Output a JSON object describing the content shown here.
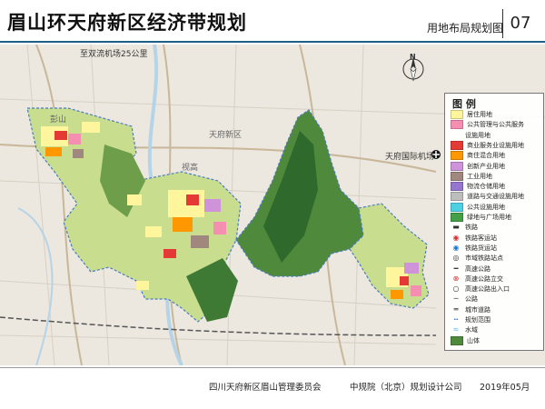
{
  "header": {
    "title": "眉山环天府新区经济带规划",
    "sheet_title": "用地布局规划图",
    "sheet_number": "07"
  },
  "map": {
    "labels": {
      "airport_distance": "至双流机场25公里",
      "airport": "天府国际机场",
      "north": "N",
      "place_1": "天府新区",
      "place_2": "视高",
      "place_3": "彭山"
    }
  },
  "legend": {
    "title": "图 例",
    "items": [
      {
        "label": "居住用地",
        "color": "#fff59d"
      },
      {
        "label": "公共管理与公共服务",
        "color": "#f48fb1"
      },
      {
        "label": "设施用地",
        "color": null
      },
      {
        "label": "商业服务业设施用地",
        "color": "#e53935"
      },
      {
        "label": "商住混合用地",
        "color": "#ff9800"
      },
      {
        "label": "创新产业用地",
        "color": "#ce93d8"
      },
      {
        "label": "工业用地",
        "color": "#a1887f"
      },
      {
        "label": "物流仓储用地",
        "color": "#9575cd"
      },
      {
        "label": "道路与交通设施用地",
        "color": "#bdbdbd"
      },
      {
        "label": "公共设施用地",
        "color": "#4dd0e1"
      },
      {
        "label": "绿地与广场用地",
        "color": "#43a047"
      },
      {
        "label": "铁路",
        "symbol": "rail"
      },
      {
        "label": "铁路客运站",
        "symbol": "circle-red"
      },
      {
        "label": "铁路货运站",
        "symbol": "circle-blue"
      },
      {
        "label": "市域铁路站点",
        "symbol": "circle-dot"
      },
      {
        "label": "高速公路",
        "symbol": "line-dark"
      },
      {
        "label": "高速公路立交",
        "symbol": "circle-x"
      },
      {
        "label": "高速公路出入口",
        "symbol": "circle-o"
      },
      {
        "label": "公路",
        "symbol": "line-gray"
      },
      {
        "label": "城市道路",
        "symbol": "line-white"
      },
      {
        "label": "规划范围",
        "symbol": "line-boundary"
      },
      {
        "label": "水域",
        "symbol": "water"
      },
      {
        "label": "山体",
        "color": "#4f8a3c"
      }
    ]
  },
  "footer": {
    "org": "四川天府新区眉山管理委员会",
    "designer": "中规院（北京）规划设计公司",
    "date": "2019年05月"
  }
}
